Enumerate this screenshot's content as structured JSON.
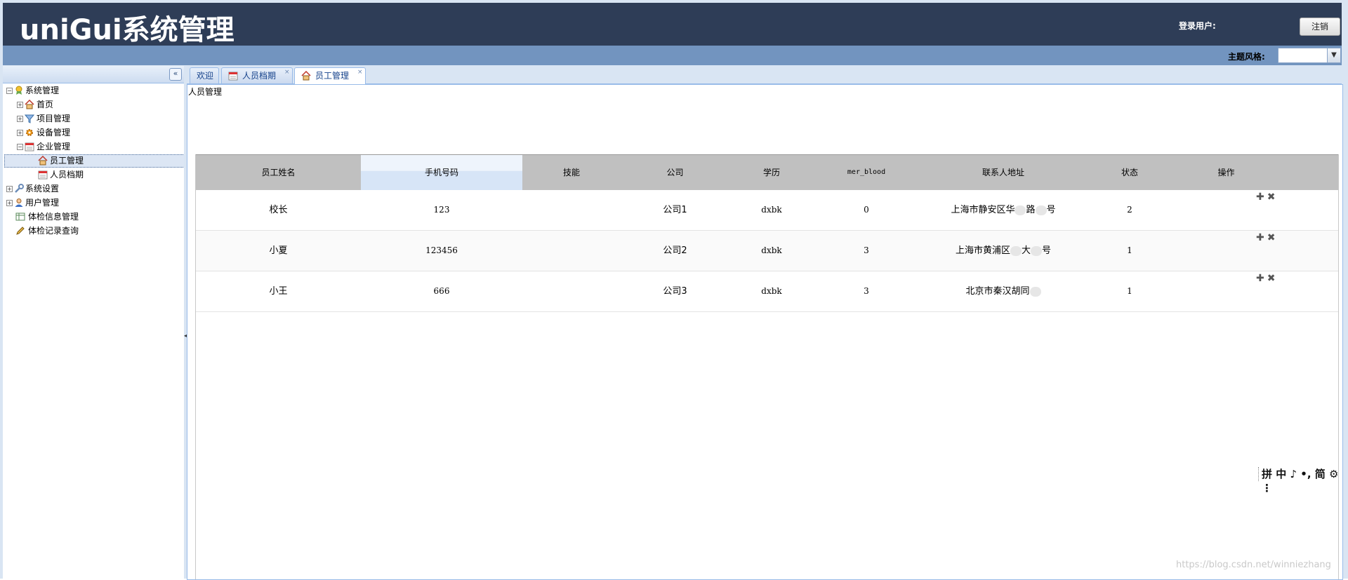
{
  "header": {
    "app_title": "uniGui系统管理",
    "login_label": "登录用户:",
    "logout_label": "注销"
  },
  "theme": {
    "label": "主题风格:",
    "selected": ""
  },
  "tree": {
    "items": [
      {
        "label": "系统管理",
        "icon": "award-icon",
        "expander": "minus"
      },
      {
        "label": "首页",
        "icon": "home-icon",
        "expander": "plus"
      },
      {
        "label": "项目管理",
        "icon": "filter-icon",
        "expander": "plus"
      },
      {
        "label": "设备管理",
        "icon": "gear-icon",
        "expander": "plus"
      },
      {
        "label": "企业管理",
        "icon": "calendar-icon",
        "expander": "minus"
      },
      {
        "label": "员工管理",
        "icon": "home-icon",
        "expander": "none"
      },
      {
        "label": "人员档期",
        "icon": "calendar-icon",
        "expander": "none"
      },
      {
        "label": "系统设置",
        "icon": "wrench-icon",
        "expander": "plus"
      },
      {
        "label": "用户管理",
        "icon": "user-icon",
        "expander": "plus"
      },
      {
        "label": "体检信息管理",
        "icon": "table-icon",
        "expander": "none"
      },
      {
        "label": "体检记录查询",
        "icon": "pen-icon",
        "expander": "none"
      }
    ]
  },
  "tabs": [
    {
      "label": "欢迎"
    },
    {
      "label": "人员档期"
    },
    {
      "label": "员工管理"
    }
  ],
  "page": {
    "title": "人员管理"
  },
  "grid": {
    "columns": [
      "员工姓名",
      "手机号码",
      "技能",
      "公司",
      "学历",
      "mer_blood",
      "联系人地址",
      "状态",
      "操作"
    ],
    "rows": [
      {
        "name": "校长",
        "phone": "123",
        "skill": "",
        "company": "公司1",
        "education": "dxbk",
        "blood": "0",
        "address_a": "上海市静安区华",
        "address_b": "路",
        "address_c": "号",
        "status": "2"
      },
      {
        "name": "小夏",
        "phone": "123456",
        "skill": "",
        "company": "公司2",
        "education": "dxbk",
        "blood": "3",
        "address_a": "上海市黄浦区",
        "address_b": "大",
        "address_c": "号",
        "status": "1"
      },
      {
        "name": "小王",
        "phone": "666",
        "skill": "",
        "company": "公司3",
        "education": "dxbk",
        "blood": "3",
        "address_a": "北京市秦汉胡同",
        "address_b": "",
        "address_c": "",
        "status": "1"
      }
    ],
    "op_add": "✚",
    "op_delete": "✖"
  },
  "ime_bar": "拼 中 ♪ •, 简 ⚙ ⋮",
  "watermark": "https://blog.csdn.net/winniezhang"
}
